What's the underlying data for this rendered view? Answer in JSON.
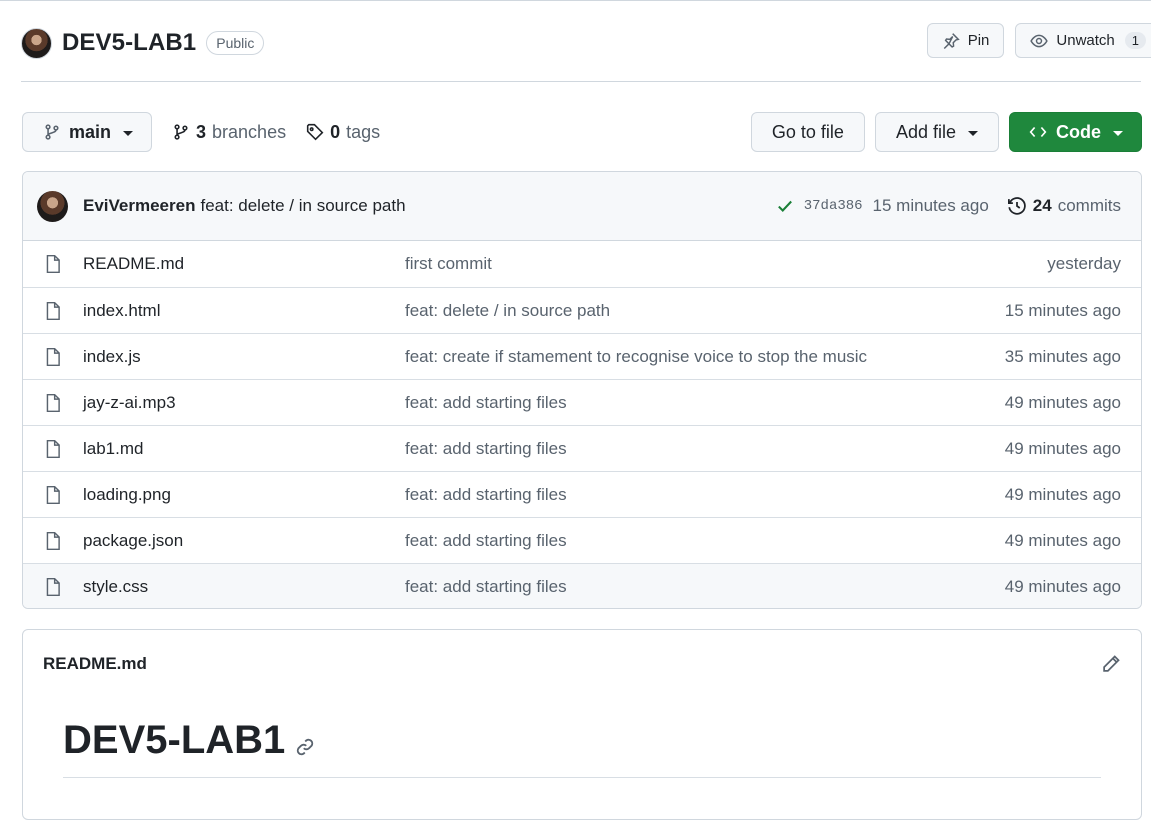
{
  "repo": {
    "name": "DEV5-LAB1",
    "visibility": "Public",
    "pin_label": "Pin",
    "watch_label": "Unwatch",
    "watch_count": "1"
  },
  "toolbar": {
    "branch": "main",
    "branches_count": "3",
    "branches_label": "branches",
    "tags_count": "0",
    "tags_label": "tags",
    "go_to_file": "Go to file",
    "add_file": "Add file",
    "code": "Code"
  },
  "commit": {
    "author": "EviVermeeren",
    "message": "feat: delete / in source path",
    "sha": "37da386",
    "time": "15 minutes ago",
    "count": "24",
    "count_label": "commits"
  },
  "files": [
    {
      "name": "README.md",
      "message": "first commit",
      "age": "yesterday"
    },
    {
      "name": "index.html",
      "message": "feat: delete / in source path",
      "age": "15 minutes ago"
    },
    {
      "name": "index.js",
      "message": "feat: create if stamement to recognise voice to stop the music",
      "age": "35 minutes ago"
    },
    {
      "name": "jay-z-ai.mp3",
      "message": "feat: add starting files",
      "age": "49 minutes ago"
    },
    {
      "name": "lab1.md",
      "message": "feat: add starting files",
      "age": "49 minutes ago"
    },
    {
      "name": "loading.png",
      "message": "feat: add starting files",
      "age": "49 minutes ago"
    },
    {
      "name": "package.json",
      "message": "feat: add starting files",
      "age": "49 minutes ago"
    },
    {
      "name": "style.css",
      "message": "feat: add starting files",
      "age": "49 minutes ago"
    }
  ],
  "readme": {
    "filename": "README.md",
    "heading": "DEV5-LAB1"
  },
  "colors": {
    "accent_green": "#1f883d",
    "check_green": "#1a7f37",
    "border": "#d0d7de",
    "muted_text": "#59636e"
  },
  "icons": [
    "pin-icon",
    "eye-icon",
    "git-branch-icon",
    "tag-icon",
    "code-icon",
    "check-icon",
    "history-icon",
    "file-icon",
    "pencil-icon",
    "link-icon"
  ]
}
